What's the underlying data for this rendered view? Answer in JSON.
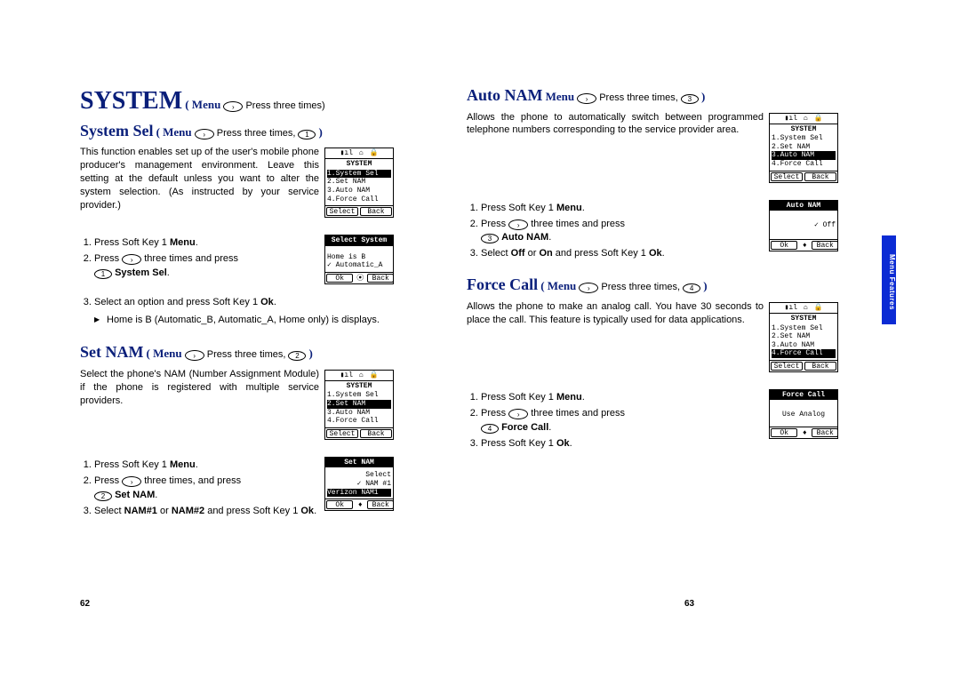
{
  "big_title": "SYSTEM",
  "big_title_menu": "( Menu",
  "big_title_tail": " Press three times)",
  "left": {
    "system_sel": {
      "head": "System Sel",
      "menu": "( Menu",
      "tail_a": " Press three times, ",
      "tail_b": " )",
      "key_glyph": "1",
      "intro": "This function enables set up of the user's mobile phone producer's management environment. Leave this setting at the default unless you want to alter the system selection. (As instructed by your service provider.)",
      "steps": {
        "s1_a": "Press Soft Key 1 ",
        "s1_b": "Menu",
        "s1_c": ".",
        "s2_a": "Press ",
        "s2_b": " three times and press",
        "s2_key": "1",
        "s2_c": " ",
        "s2_d": "System Sel",
        "s2_e": ".",
        "s3_a": "Select an option and press Soft Key 1 ",
        "s3_b": "Ok",
        "s3_c": "."
      },
      "arrow_note": "Home is B (Automatic_B, Automatic_A, Home only) is displays.",
      "phone1": {
        "title": "SYSTEM",
        "r1": "1.System Sel",
        "r2": "2.Set NAM",
        "r3": "3.Auto NAM",
        "r4": "4.Force Call",
        "foot_l": "Select",
        "foot_r": "Back"
      },
      "phone2": {
        "title": "Select System",
        "r1": "Home is B",
        "r2": "✓ Automatic_A",
        "foot_l": "Ok",
        "foot_m": "⦿",
        "foot_r": "Back"
      }
    },
    "set_nam": {
      "head": "Set NAM",
      "menu": "( Menu",
      "tail_a": " Press three times, ",
      "tail_b": " )",
      "key_glyph": "2",
      "intro": "Select the phone's NAM (Number Assignment Module) if the phone is registered with multiple service providers.",
      "steps": {
        "s1_a": "Press Soft Key 1 ",
        "s1_b": "Menu",
        "s1_c": ".",
        "s2_a": "Press ",
        "s2_b": " three times, and press",
        "s2_key": "2",
        "s2_c": " ",
        "s2_d": "Set NAM",
        "s2_e": ".",
        "s3_a": "Select ",
        "s3_b": "NAM#1",
        "s3_mid": " or ",
        "s3_c": "NAM#2",
        "s3_d": " and press Soft Key 1 ",
        "s3_e": "Ok",
        "s3_f": "."
      },
      "phone1": {
        "title": "SYSTEM",
        "r1": "1.System Sel",
        "r2": "2.Set NAM",
        "r3": "3.Auto NAM",
        "r4": "4.Force Call",
        "foot_l": "Select",
        "foot_r": "Back"
      },
      "phone2": {
        "title": "Set NAM",
        "r1": "Select",
        "r2": "✓ NAM #1",
        "r3": "Verizon NAM1",
        "foot_l": "Ok",
        "foot_m": "♦",
        "foot_r": "Back"
      }
    },
    "page_num": "62"
  },
  "right": {
    "auto_nam": {
      "head": "Auto NAM",
      "menu": " Menu",
      "tail_a": " Press three times, ",
      "tail_b": " )",
      "key_glyph": "3",
      "intro": "Allows the phone to automatically switch between programmed telephone numbers corresponding to the service provider area.",
      "steps": {
        "s1_a": "Press Soft Key 1 ",
        "s1_b": "Menu",
        "s1_c": ".",
        "s2_a": "Press ",
        "s2_b": " three times and press",
        "s2_key": "3",
        "s2_c": " ",
        "s2_d": "Auto NAM",
        "s2_e": ".",
        "s3_a": "Select ",
        "s3_b": "Off",
        "s3_mid": " or ",
        "s3_c": "On",
        "s3_d": " and press Soft Key 1 ",
        "s3_e": "Ok",
        "s3_f": "."
      },
      "phone1": {
        "title": "SYSTEM",
        "r1": "1.System Sel",
        "r2": "2.Set NAM",
        "r3": "3.Auto NAM",
        "r4": "4.Force Call",
        "foot_l": "Select",
        "foot_r": "Back"
      },
      "phone2": {
        "title": "Auto NAM",
        "r1": "✓ Off",
        "foot_l": "Ok",
        "foot_m": "♦",
        "foot_r": "Back"
      }
    },
    "force_call": {
      "head": "Force Call",
      "menu": "( Menu",
      "tail_a": " Press three times, ",
      "tail_b": " )",
      "key_glyph": "4",
      "intro": "Allows the phone to make an analog call. You have 30 seconds to place the call. This feature is typically used for data applications.",
      "steps": {
        "s1_a": "Press Soft Key 1 ",
        "s1_b": "Menu",
        "s1_c": ".",
        "s2_a": "Press ",
        "s2_b": " three times and press",
        "s2_key": "4",
        "s2_c": " ",
        "s2_d": "Force Call",
        "s2_e": ".",
        "s3_a": "Press Soft Key 1 ",
        "s3_b": "Ok",
        "s3_c": "."
      },
      "phone1": {
        "title": "SYSTEM",
        "r1": "1.System Sel",
        "r2": "2.Set NAM",
        "r3": "3.Auto NAM",
        "r4": "4.Force Call",
        "foot_l": "Select",
        "foot_r": "Back"
      },
      "phone2": {
        "title": "Force Call",
        "r1": "Use Analog",
        "foot_l": "Ok",
        "foot_m": "♦",
        "foot_r": "Back"
      }
    },
    "page_num": "63"
  },
  "oval_arrow": "›",
  "side_tab": "Menu Features"
}
